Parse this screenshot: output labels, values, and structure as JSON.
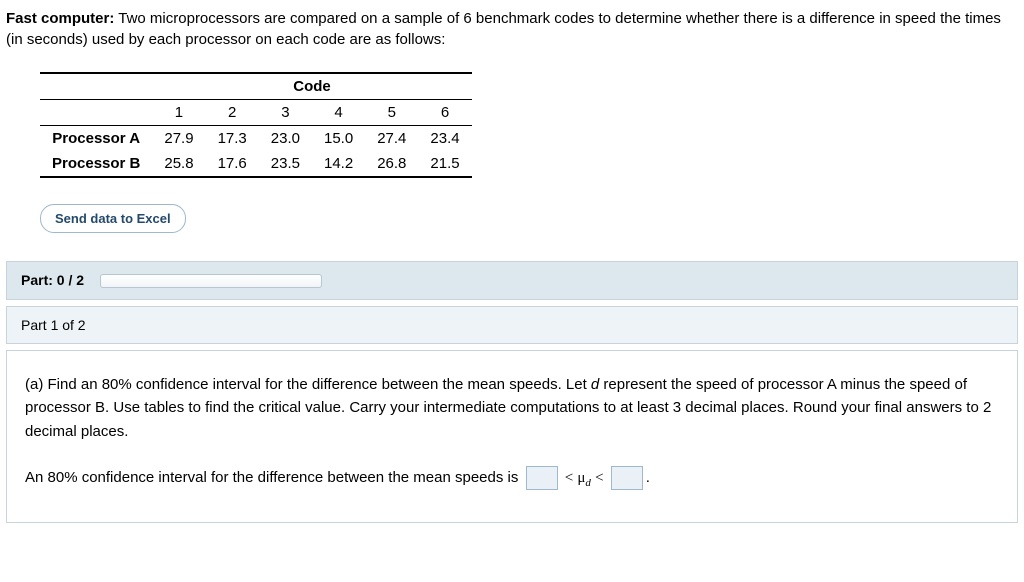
{
  "intro": {
    "bold_lead": "Fast computer:",
    "rest": " Two microprocessors are compared on a sample of 6 benchmark codes to determine whether there is a difference in speed the times (in seconds) used by each processor on each code are as follows:"
  },
  "table": {
    "header_label": "Code",
    "cols": [
      "1",
      "2",
      "3",
      "4",
      "5",
      "6"
    ],
    "rows": [
      {
        "label": "Processor A",
        "vals": [
          "27.9",
          "17.3",
          "23.0",
          "15.0",
          "27.4",
          "23.4"
        ]
      },
      {
        "label": "Processor B",
        "vals": [
          "25.8",
          "17.6",
          "23.5",
          "14.2",
          "26.8",
          "21.5"
        ]
      }
    ]
  },
  "excel_button": "Send data to Excel",
  "progress": {
    "label": "Part: 0 / 2"
  },
  "part_header": "Part 1 of 2",
  "question": {
    "body": "(a) Find an 80% confidence interval for the difference between the mean speeds. Let d represent the speed of processor A minus the speed of processor B. Use tables to find the critical value. Carry your intermediate computations to at least 3 decimal places. Round your final answers to 2 decimal places.",
    "answer_lead": "An 80% confidence interval for the difference between the mean speeds is",
    "lt1": "<",
    "mu": "μ",
    "mu_sub": "d",
    "lt2": "<",
    "period": "."
  },
  "chart_data": {
    "type": "table",
    "title": "Benchmark times (seconds) by processor",
    "categories": [
      "1",
      "2",
      "3",
      "4",
      "5",
      "6"
    ],
    "series": [
      {
        "name": "Processor A",
        "values": [
          27.9,
          17.3,
          23.0,
          15.0,
          27.4,
          23.4
        ]
      },
      {
        "name": "Processor B",
        "values": [
          25.8,
          17.6,
          23.5,
          14.2,
          26.8,
          21.5
        ]
      }
    ]
  }
}
